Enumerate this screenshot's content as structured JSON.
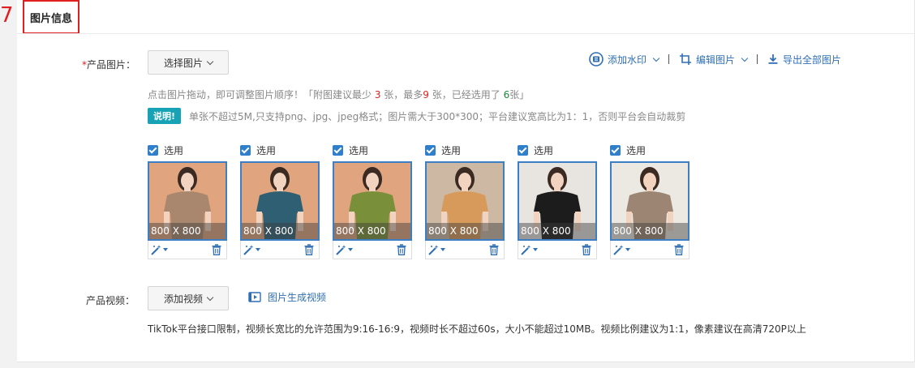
{
  "step_number": "7",
  "section_title": "图片信息",
  "product_images": {
    "required_mark": "*",
    "label": "产品图片：",
    "select_button": "选择图片",
    "toolbar": {
      "watermark": "添加水印",
      "edit": "编辑图片",
      "export": "导出全部图片"
    },
    "tip": {
      "prefix": "点击图片拖动，即可调整图片顺序！「附图建议最少 ",
      "min": "3",
      "mid": " 张，最多",
      "max": "9",
      "mid2": " 张，已经选用了 ",
      "selected": "6",
      "suffix": "张」"
    },
    "note_badge": "说明!",
    "note_text": "单张不超过5M,只支持png、jpg、jpeg格式；图片需大于300*300；平台建议宽高比为1：1，否则平台会自动裁剪",
    "images": [
      {
        "check_label": "选用",
        "dims": "800 X 800",
        "shirt_color": "#a8876e",
        "bg_color": "#e0a47e"
      },
      {
        "check_label": "选用",
        "dims": "800 X 800",
        "shirt_color": "#2f5f73",
        "bg_color": "#e0a47e"
      },
      {
        "check_label": "选用",
        "dims": "800 X 800",
        "shirt_color": "#7a8f3a",
        "bg_color": "#e0a47e"
      },
      {
        "check_label": "选用",
        "dims": "800 X 800",
        "shirt_color": "#d89a5a",
        "bg_color": "#cdb8a4"
      },
      {
        "check_label": "选用",
        "dims": "800 X 800",
        "shirt_color": "#1c1c1c",
        "bg_color": "#e8e4e0"
      },
      {
        "check_label": "选用",
        "dims": "800 X 800",
        "shirt_color": "#9c8572",
        "bg_color": "#ece8e2"
      }
    ]
  },
  "product_video": {
    "label": "产品视频：",
    "add_button": "添加视频",
    "generate_link": "图片生成视频",
    "note": "TikTok平台接口限制，视频长宽比的允许范围为9:16-16:9，视频时长不超过60s，大小不能超过10MB。视频比例建议为1:1，像素建议在高清720P以上"
  },
  "colors": {
    "accent_blue": "#2f6fb5",
    "highlight_red": "#e02020",
    "badge_teal": "#17a3b5"
  }
}
